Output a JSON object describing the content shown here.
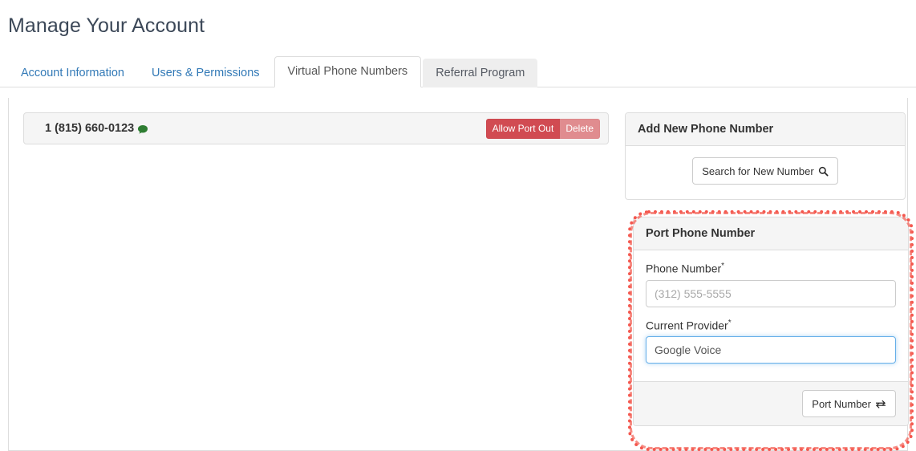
{
  "page": {
    "title": "Manage Your Account"
  },
  "tabs": [
    {
      "label": "Account Information",
      "state": "normal"
    },
    {
      "label": "Users & Permissions",
      "state": "normal"
    },
    {
      "label": "Virtual Phone Numbers",
      "state": "active"
    },
    {
      "label": "Referral Program",
      "state": "hovered"
    }
  ],
  "numbers": [
    {
      "number": "1 (815) 660-0123",
      "sms_icon": "comment-icon",
      "sms_icon_glyph": "💬",
      "sms_icon_color": "#2e7d32",
      "allow_port_out_label": "Allow Port Out",
      "delete_label": "Delete"
    }
  ],
  "add_number_panel": {
    "heading": "Add New Phone Number",
    "search_button_label": "Search for New Number",
    "search_icon": "search-icon"
  },
  "port_panel": {
    "heading": "Port Phone Number",
    "highlighted": true,
    "highlight_color": "#f4574e",
    "phone_number": {
      "label": "Phone Number",
      "required_marker": "*",
      "value": "",
      "placeholder": "(312) 555-5555",
      "focused": false
    },
    "current_provider": {
      "label": "Current Provider",
      "required_marker": "*",
      "value": "Google Voice",
      "placeholder": "",
      "focused": true
    },
    "submit_button_label": "Port Number",
    "submit_icon": "exchange-icon"
  },
  "colors": {
    "link": "#337ab7",
    "danger": "#d14b52",
    "danger_muted": "#e08c8f",
    "panel_heading_bg": "#f5f5f5",
    "border": "#dddddd",
    "focus_border": "#66afe9",
    "highlight": "#f4574e"
  }
}
